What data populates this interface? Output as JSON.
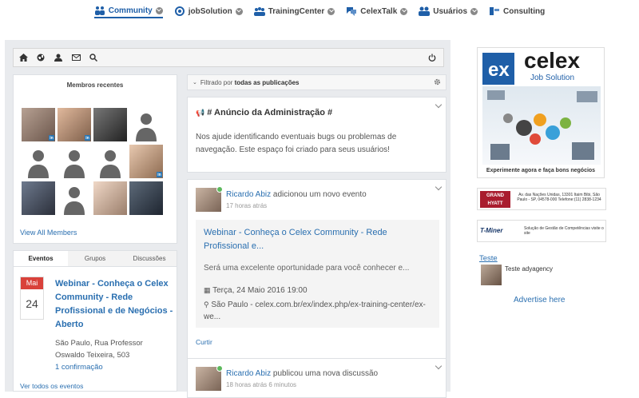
{
  "nav": {
    "items": [
      {
        "label": "Community",
        "icon": "community-icon"
      },
      {
        "label": "jobSolution",
        "icon": "jobsolution-icon"
      },
      {
        "label": "TrainingCenter",
        "icon": "training-icon"
      },
      {
        "label": "CelexTalk",
        "icon": "chat-icon"
      },
      {
        "label": "Usuários",
        "icon": "users-icon"
      },
      {
        "label": "Consulting",
        "icon": "consulting-icon"
      }
    ]
  },
  "members": {
    "title": "Membros recentes",
    "view_all": "View All Members"
  },
  "events": {
    "tabs": [
      "Eventos",
      "Grupos",
      "Discussões"
    ],
    "month": "Mai",
    "day": "24",
    "title": "Webinar - Conheça o Celex Community - Rede Profissional e de Negócios - Aberto",
    "address": "São Paulo, Rua Professor Oswaldo Teixeira, 503",
    "confirmations": "1 confirmação",
    "see_all": "Ver todos os eventos"
  },
  "filter": {
    "prefix": "Filtrado por",
    "value": "todas as publicações"
  },
  "announcement": {
    "title": "# Anúncio da Administração #",
    "body": "Nos ajude identificando eventuais bugs ou problemas de navegação. Este espaço foi criado para seus usuários!"
  },
  "post1": {
    "author": "Ricardo Abiz",
    "action": "adicionou um novo evento",
    "time": "17 horas atrás",
    "share_title": "Webinar - Conheça o Celex Community - Rede Profissional e...",
    "share_desc": "Será uma excelente oportunidade para você conhecer e...",
    "share_date": "Terça, 24 Maio 2016 19:00",
    "share_loc": "São Paulo - celex.com.br/ex/index.php/ex-training-center/ex-we...",
    "like": "Curtir"
  },
  "post2": {
    "author": "Ricardo Abiz",
    "action": "publicou uma nova discussão",
    "time": "18 horas atrás 6 minutos"
  },
  "ads": {
    "celex_brand": "celex",
    "celex_sub": "Job Solution",
    "celex_caption": "Experimente agora e faça bons negócios",
    "hyatt_logo": "GRAND HYATT",
    "hyatt_text": "Av. das Nações Unidas, 13301 Itaim Bibi, São Paulo - SP, 04578-000 Telefone:(11) 2838-1234",
    "tminer_logo": "T-Miner",
    "tminer_text": "Solução de Gestão de Competências visite o site",
    "teste_link": "Teste",
    "teste_text": "Teste adyagency",
    "advertise": "Advertise here"
  },
  "colors": {
    "accent": "#1f5fa8",
    "link": "#2a6fb0",
    "event_red": "#d9413a"
  }
}
